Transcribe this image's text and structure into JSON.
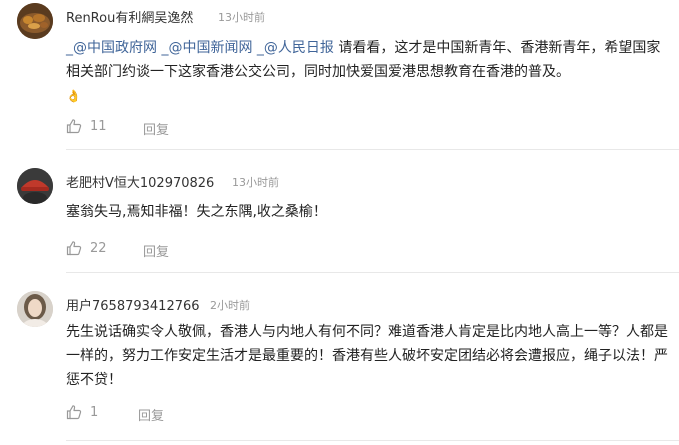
{
  "comments": [
    {
      "username": "RenRou有利網吴逸然",
      "time": "13小时前",
      "mentions": [
        "_@中国政府网",
        "_@中国新闻网",
        "_@人民日报"
      ],
      "text": " 请看看，这才是中国新青年、香港新青年，希望国家相关部门约谈一下这家香港公交公司，同时加快爱国爱港思想教育在香港的普及。",
      "emoji": "👌",
      "likes": "11",
      "reply_label": "回复"
    },
    {
      "username": "老肥村V恒大102970826",
      "time": "13小时前",
      "text": "塞翁失马,焉知非福！失之东隅,收之桑榆！",
      "likes": "22",
      "reply_label": "回复"
    },
    {
      "username": "用户7658793412766",
      "time": "2小时前",
      "text": "先生说话确实令人敬佩，香港人与内地人有何不同？难道香港人肯定是比内地人高上一等？人都是一样的，努力工作安定生活才是最重要的！香港有些人破坏安定团结必将会遭报应，绳子以法！严惩不贷！",
      "likes": "1",
      "reply_label": "回复"
    }
  ],
  "icons": {
    "like": "thumbs-up-icon",
    "avatar_1": "food-avatar",
    "avatar_2": "red-cap-avatar",
    "avatar_3": "portrait-avatar"
  },
  "colors": {
    "mention": "#406599",
    "meta": "#999999",
    "text": "#222222",
    "divider": "#e8e8e8"
  }
}
